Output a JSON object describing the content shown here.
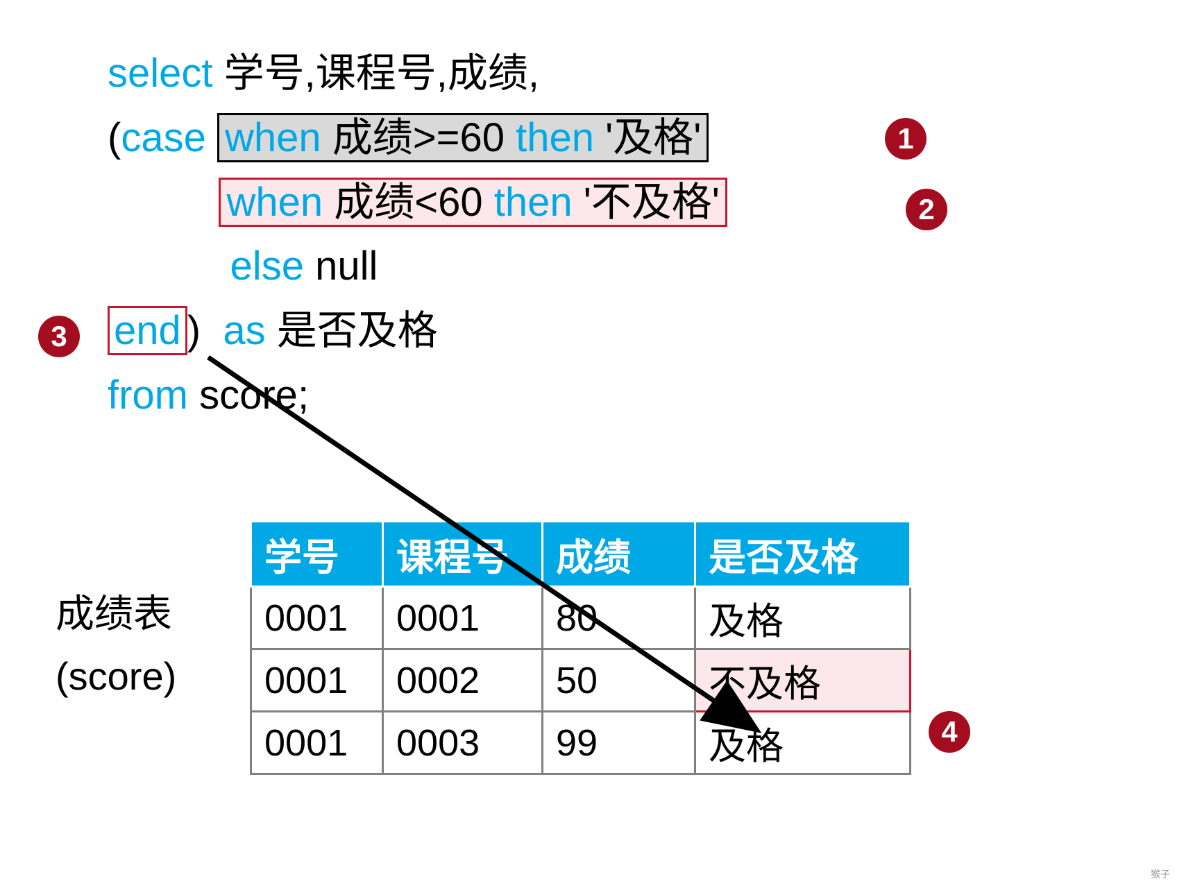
{
  "sql": {
    "select": "select",
    "cols": " 学号,课程号,成绩,",
    "lp": "(",
    "case": "case ",
    "when1_when": "when",
    "when1_cond": " 成绩>=60 ",
    "when1_then": "then",
    "when1_val": " '及格'",
    "when2_when": "when",
    "when2_cond": " 成绩<60 ",
    "when2_then": "then",
    "when2_val": " '不及格'",
    "else": "else",
    "else_val": " null",
    "end": "end",
    "rp": ")",
    "as": "as",
    "alias": " 是否及格",
    "from": "from",
    "table": " score;"
  },
  "badges": {
    "b1": "1",
    "b2": "2",
    "b3": "3",
    "b4": "4"
  },
  "tableLabel": {
    "line1": "成绩表",
    "line2": "(score)"
  },
  "headers": {
    "c1": "学号",
    "c2": "课程号",
    "c3": "成绩",
    "c4": "是否及格"
  },
  "rows": [
    {
      "c1": "0001",
      "c2": "0001",
      "c3": "80",
      "c4": "及格"
    },
    {
      "c1": "0001",
      "c2": "0002",
      "c3": "50",
      "c4": "不及格"
    },
    {
      "c1": "0001",
      "c2": "0003",
      "c3": "99",
      "c4": "及格"
    }
  ],
  "footer": "猴子"
}
